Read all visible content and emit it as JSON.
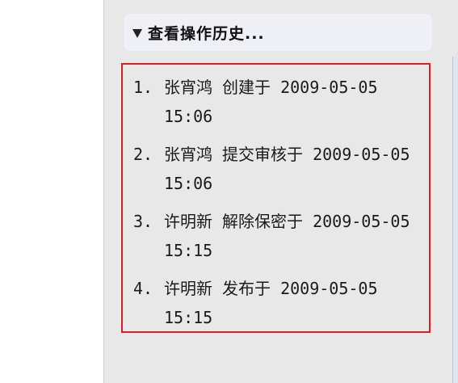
{
  "history": {
    "title": "查看操作历史...",
    "items": [
      {
        "num": "1.",
        "text": "张宵鸿 创建于 2009-05-05 15:06"
      },
      {
        "num": "2.",
        "text": "张宵鸿 提交审核于 2009-05-05 15:06"
      },
      {
        "num": "3.",
        "text": "许明新 解除保密于 2009-05-05 15:15"
      },
      {
        "num": "4.",
        "text": "许明新 发布于 2009-05-05 15:15"
      }
    ]
  },
  "icons": {
    "toggle": "triangle-down-icon"
  },
  "colors": {
    "panel_bg": "#e8e8e8",
    "header_bg": "#eef0f6",
    "highlight_border": "#d9202a",
    "text": "#1a1a1a"
  }
}
